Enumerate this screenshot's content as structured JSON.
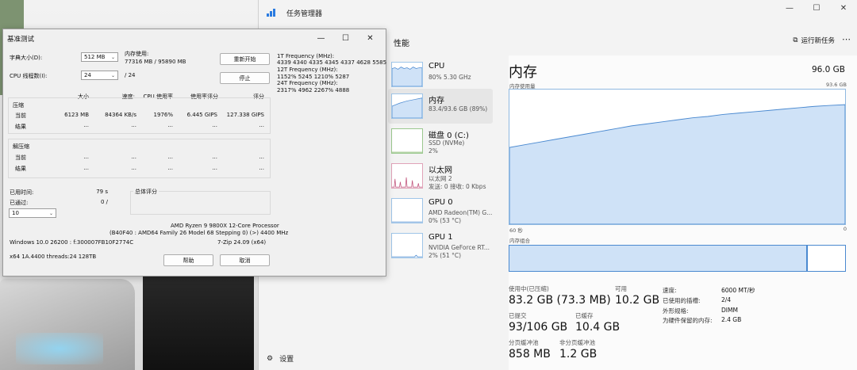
{
  "taskmgr": {
    "title": "任务管理器",
    "section": "性能",
    "run_new_task": "运行新任务",
    "settings": "设置",
    "items": [
      {
        "name": "CPU",
        "sub1": "80%  5.30 GHz",
        "sub2": ""
      },
      {
        "name": "内存",
        "sub1": "83.4/93.6 GB (89%)",
        "sub2": ""
      },
      {
        "name": "磁盘 0 (C:)",
        "sub1": "SSD (NVMe)",
        "sub2": "2%"
      },
      {
        "name": "以太网",
        "sub1": "以太网 2",
        "sub2": "发送: 0 接收: 0 Kbps"
      },
      {
        "name": "GPU 0",
        "sub1": "AMD Radeon(TM) G...",
        "sub2": "0% (53 °C)"
      },
      {
        "name": "GPU 1",
        "sub1": "NVIDIA GeForce RT...",
        "sub2": "2% (51 °C)"
      }
    ],
    "memory": {
      "title": "内存",
      "total": "96.0 GB",
      "usage_label": "内存使用量",
      "usage_max": "93.6 GB",
      "x_left": "60 秒",
      "x_right": "0",
      "composition_label": "内存组合",
      "composition_used_fraction": 0.89,
      "usage_series": [
        0.57,
        0.59,
        0.61,
        0.63,
        0.65,
        0.67,
        0.69,
        0.71,
        0.73,
        0.745,
        0.76,
        0.775,
        0.79,
        0.8,
        0.815,
        0.825,
        0.835,
        0.845,
        0.855,
        0.865,
        0.875,
        0.882,
        0.888
      ],
      "in_use_label": "使用中(已压缩)",
      "in_use_value": "83.2 GB (73.3 MB)",
      "available_label": "可用",
      "available_value": "10.2 GB",
      "committed_label": "已提交",
      "committed_value": "93/106 GB",
      "cached_label": "已缓存",
      "cached_value": "10.4 GB",
      "paged_label": "分页缓冲池",
      "paged_value": "858 MB",
      "nonpaged_label": "非分页缓冲池",
      "nonpaged_value": "1.2 GB",
      "speed_label": "速度:",
      "speed_value": "6000 MT/秒",
      "slots_label": "已使用的插槽:",
      "slots_value": "2/4",
      "form_label": "外形规格:",
      "form_value": "DIMM",
      "reserved_label": "为硬件保留的内存:",
      "reserved_value": "2.4 GB"
    }
  },
  "bench": {
    "title": "基准测试",
    "dict_label": "字典大小(D):",
    "dict_value": "512 MB",
    "mem_use_label": "内存使用:",
    "mem_use_value": "77316 MB / 95890 MB",
    "threads_label": "CPU 线程数(I):",
    "threads_value": "24",
    "threads_total": "/ 24",
    "restart": "重新开始",
    "stop": "停止",
    "freq1_label": "1T Frequency (MHz):",
    "freq1_value": "4339 4340 4335 4345 4337 4628 5585",
    "freq12_label": "12T Frequency (MHz):",
    "freq12_value": "1152% 5245 1210% 5287",
    "freq24_label": "24T Frequency (MHz):",
    "freq24_value": "2317% 4962 2267% 4888",
    "col_size": "大小",
    "col_speed": "速度:",
    "col_cpu": "CPU 使用率",
    "col_rating_usage": "使用率评分",
    "col_rating": "评分",
    "compress_label": "压缩",
    "current": "当前",
    "result": "结果",
    "decompress_label": "解压缩",
    "cur_size": "6123 MB",
    "cur_speed": "84364 KB/s",
    "cur_cpu": "1976%",
    "cur_ru": "6.445 GIPS",
    "cur_rating": "127.338 GIPS",
    "dots": "...",
    "elapsed_label": "已用时间:",
    "elapsed_value": "79 s",
    "passed_label": "已通过:",
    "passed_value": "0 /",
    "total_rating_label": "总体评分",
    "passes_select": "10",
    "cpu_name": "AMD Ryzen 9 9800X 12-Core Processor",
    "cpu_detail": "(B40F40 : AMD64 Family 26 Model 68 Stepping 0) (>) 4400 MHz",
    "os": "Windows 10.0 26200  :  f:300007FB10F2774C",
    "zip": "7-Zip 24.09 (x64)",
    "arch": "x64 1A.4400 threads:24 128TB",
    "help": "帮助",
    "cancel": "取消"
  }
}
